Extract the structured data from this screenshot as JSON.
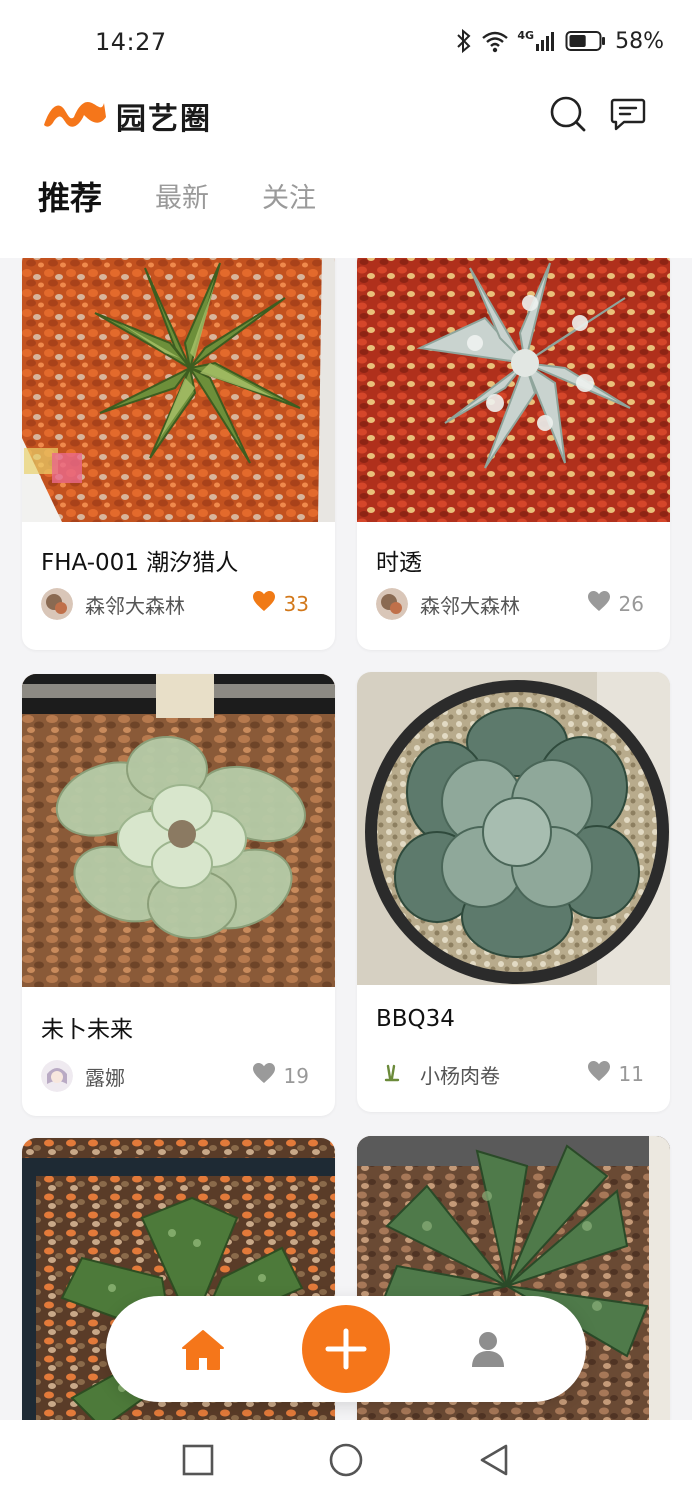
{
  "status_bar": {
    "time": "14:27",
    "network_label": "4G",
    "battery_percent": "58%",
    "battery_level": 0.58,
    "icons": [
      "bluetooth-icon",
      "wifi-icon",
      "signal-icon",
      "battery-icon"
    ]
  },
  "header": {
    "app_name": "园艺圈",
    "search_icon": "search-icon",
    "message_icon": "message-icon"
  },
  "tabs": [
    {
      "label": "推荐",
      "active": true
    },
    {
      "label": "最新",
      "active": false
    },
    {
      "label": "关注",
      "active": false
    }
  ],
  "feed": {
    "cards": [
      {
        "title": "FHA-001 潮汐猎人",
        "author": "森邻大森林",
        "likes": "33",
        "liked": true
      },
      {
        "title": "时透",
        "author": "森邻大森林",
        "likes": "26",
        "liked": false
      },
      {
        "title": "未卜未来",
        "author": "露娜",
        "likes": "19",
        "liked": false
      },
      {
        "title": "BBQ34",
        "author": "小杨肉卷",
        "likes": "11",
        "liked": false
      }
    ]
  },
  "bottom_nav": {
    "items": [
      "home-icon",
      "add-icon",
      "profile-icon"
    ],
    "active": "home"
  },
  "colors": {
    "accent": "#f5761a",
    "liked_heart": "#f07a16",
    "like_text": "#d2781a",
    "muted": "#9a9a9a"
  }
}
